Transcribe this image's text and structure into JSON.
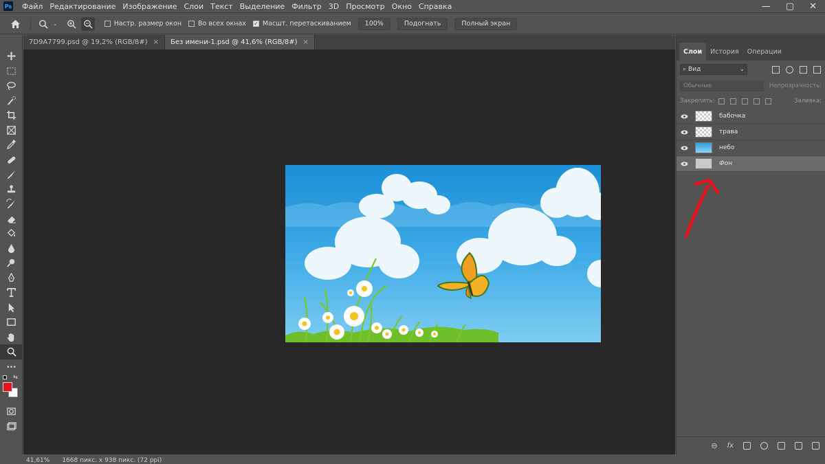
{
  "app": {
    "logo": "Ps",
    "accent": "#31a8ff"
  },
  "menu": {
    "items": [
      "Файл",
      "Редактирование",
      "Изображение",
      "Слои",
      "Текст",
      "Выделение",
      "Фильтр",
      "3D",
      "Просмотр",
      "Окно",
      "Справка"
    ],
    "window_controls": [
      "—",
      "▢",
      "✕"
    ]
  },
  "options": {
    "check1": "Настр. размер окон",
    "check2": "Во всех окнах",
    "check3": "Масшт. перетаскиванием",
    "check3_checked": true,
    "btn_100": "100%",
    "btn_fit": "Подогнать",
    "btn_full": "Полный экран"
  },
  "tabs": [
    {
      "label": "7D9A7799.psd @ 19,2% (RGB/8#)"
    },
    {
      "label": "Без имени-1.psd @ 41,6% (RGB/8#)"
    }
  ],
  "tab_close": "×",
  "status": {
    "zoom": "41,61%",
    "info": "1668 пикс. x 938 пикс. (72 ppi)"
  },
  "panel": {
    "tabs": [
      "Слои",
      "История",
      "Операции"
    ],
    "search_label": "Вид",
    "blend_mode": "Обычные",
    "opacity_label": "Непрозрачность:",
    "lock_label": "Закрепить:",
    "fill_label": "Заливка:",
    "layers": [
      {
        "name": "бабочка",
        "italic": false
      },
      {
        "name": "трава",
        "italic": false
      },
      {
        "name": "небо",
        "italic": false
      },
      {
        "name": "Фон",
        "italic": true
      }
    ],
    "footer_fx": "fx"
  },
  "colors": {
    "foreground": "#e8101a",
    "background": "#ffffff",
    "annotation_arrow": "#e8101a"
  }
}
